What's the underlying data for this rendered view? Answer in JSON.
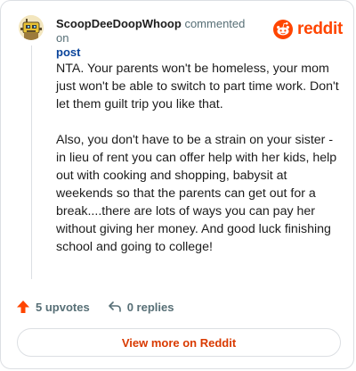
{
  "comment": {
    "author": "ScoopDeeDoopWhoop",
    "action_text": "commented on",
    "target_link": "post",
    "paragraphs": [
      "NTA. Your parents won't be homeless, your mom just won't be able to switch to part time work. Don't let them guilt trip you like that.",
      "Also, you don't have to be a strain on your sister - in lieu of rent you can offer help with her kids, help out with cooking and shopping, babysit at weekends so that the parents can get out for a break....there are lots of ways you can pay her without giving her money. And good luck finishing school and going to college!"
    ]
  },
  "brand": {
    "wordmark": "reddit",
    "color": "#ff4500"
  },
  "actions": {
    "upvotes_label": "5 upvotes",
    "replies_label": "0 replies",
    "upvote_color": "#ff4500"
  },
  "footer": {
    "view_more_label": "View more on Reddit"
  }
}
